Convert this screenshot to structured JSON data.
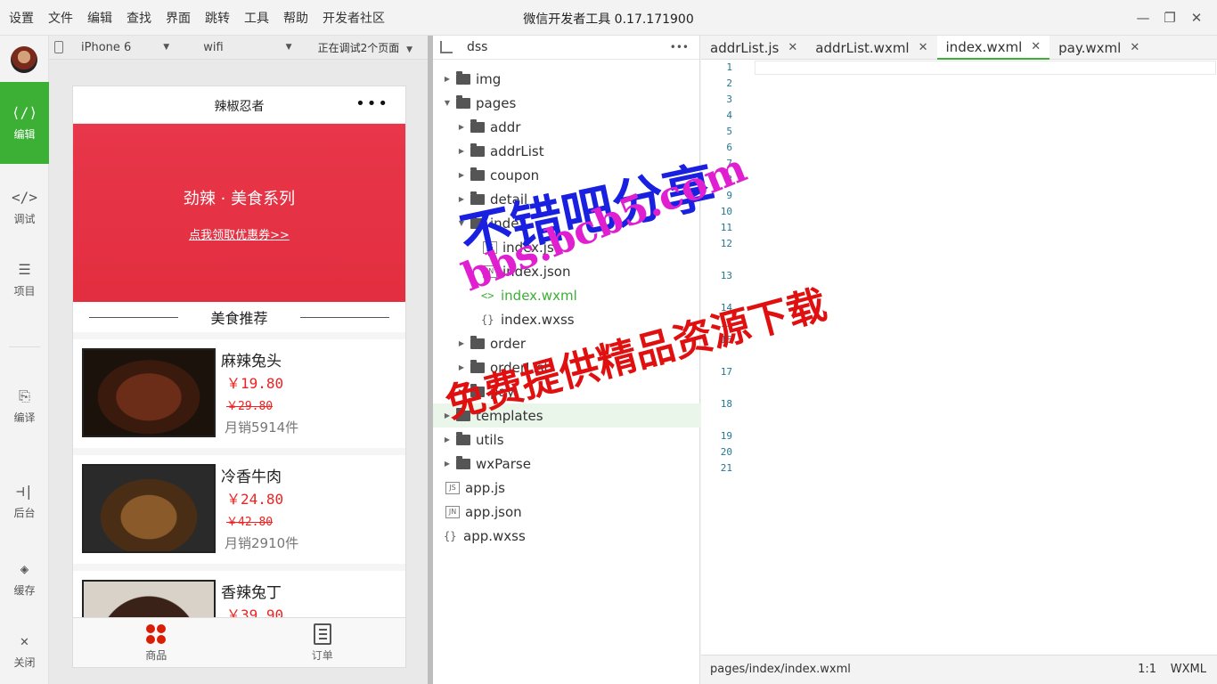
{
  "titlebar": {
    "menus": [
      "设置",
      "文件",
      "编辑",
      "查找",
      "界面",
      "跳转",
      "工具",
      "帮助",
      "开发者社区"
    ],
    "title": "微信开发者工具 0.17.171900"
  },
  "activity": {
    "items": [
      {
        "label": "编辑",
        "icon": "code-icon"
      },
      {
        "label": "调试",
        "icon": "debug-icon"
      },
      {
        "label": "项目",
        "icon": "menu-icon"
      },
      {
        "label": "编译",
        "icon": "compile-icon"
      },
      {
        "label": "后台",
        "icon": "backend-icon"
      },
      {
        "label": "缓存",
        "icon": "layers-icon"
      },
      {
        "label": "关闭",
        "icon": "close-icon"
      }
    ]
  },
  "simbar": {
    "device": "iPhone 6",
    "network": "wifi",
    "debug": "正在调试2个页面"
  },
  "phone": {
    "nav_title": "辣椒忍者",
    "nav_dots": "•••",
    "slogan": "劲辣 · 美食系列",
    "coupon": "点我领取优惠券>>",
    "cutoff": "美食推荐",
    "goods": [
      {
        "name": "麻辣兔头",
        "price": "￥19.80",
        "old_price": "￥29.80",
        "sales": "月销5914件"
      },
      {
        "name": "冷香牛肉",
        "price": "￥24.80",
        "old_price": "￥42.80",
        "sales": "月销2910件"
      },
      {
        "name": "香辣兔丁",
        "price": "￥39.90",
        "old_price": "",
        "sales": ""
      }
    ],
    "tabs": [
      {
        "label": "商品"
      },
      {
        "label": "订单"
      }
    ]
  },
  "explorer": {
    "project": "dss",
    "more": "•••",
    "rows": [
      {
        "name": "img"
      },
      {
        "name": "pages"
      },
      {
        "name": "addr"
      },
      {
        "name": "addrList"
      },
      {
        "name": "coupon"
      },
      {
        "name": "detail"
      },
      {
        "name": "index"
      },
      {
        "name": "index.js"
      },
      {
        "name": "index.json"
      },
      {
        "name": "index.wxml"
      },
      {
        "name": "index.wxss"
      },
      {
        "name": "order"
      },
      {
        "name": "orderList"
      },
      {
        "name": "pay"
      },
      {
        "name": "templates"
      },
      {
        "name": "utils"
      },
      {
        "name": "wxParse"
      },
      {
        "name": "app.js"
      },
      {
        "name": "app.json"
      },
      {
        "name": "app.wxss"
      }
    ]
  },
  "editor": {
    "tabs": [
      "addrList.js",
      "addrList.wxml",
      "index.wxml",
      "pay.wxml"
    ],
    "lines": [
      "1",
      "2",
      "3",
      "4",
      "5",
      "6",
      "7",
      "8",
      "9",
      "10",
      "11",
      "12",
      "13",
      "14",
      "15",
      "16",
      "17",
      "18",
      "19",
      "20",
      "21"
    ]
  },
  "status": {
    "path": "pages/index/index.wxml",
    "position": "1:1",
    "language": "WXML"
  },
  "watermark": {
    "line1": "不错吧分享",
    "line2": "bbs.bcb5.com",
    "line3": "免费提供精品资源下载"
  },
  "colors": {
    "accent_green": "#3cb035",
    "banner_red": "#e63946",
    "price_red": "#e22222"
  }
}
